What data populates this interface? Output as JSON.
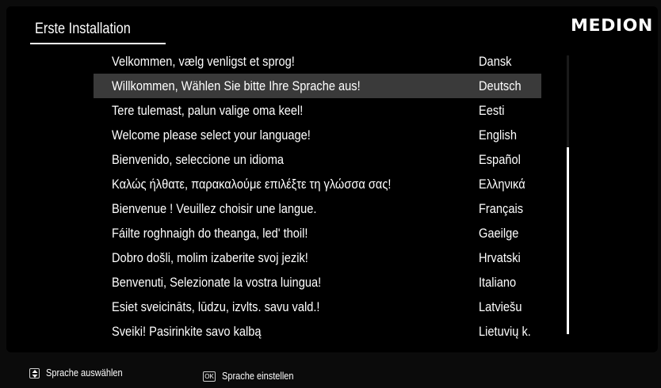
{
  "header": {
    "title": "Erste Installation",
    "brand": "MEDION"
  },
  "languages": [
    {
      "greeting": "Velkommen, vælg venligst et sprog!",
      "language": "Dansk",
      "selected": false
    },
    {
      "greeting": "Willkommen, Wählen Sie bitte Ihre Sprache aus!",
      "language": "Deutsch",
      "selected": true
    },
    {
      "greeting": "Tere tulemast, palun valige oma keel!",
      "language": "Eesti",
      "selected": false
    },
    {
      "greeting": "Welcome please select your language!",
      "language": "English",
      "selected": false
    },
    {
      "greeting": "Bienvenido, seleccione un idioma",
      "language": "Español",
      "selected": false
    },
    {
      "greeting": "Καλώς ήλθατε, παρακαλούμε επιλέξτε τη γλώσσα σας!",
      "language": "Ελληνικά",
      "selected": false
    },
    {
      "greeting": "Bienvenue ! Veuillez choisir une langue.",
      "language": "Français",
      "selected": false
    },
    {
      "greeting": "Fáilte roghnaigh do theanga, led' thoil!",
      "language": "Gaeilge",
      "selected": false
    },
    {
      "greeting": "Dobro došli, molim izaberite svoj jezik!",
      "language": "Hrvatski",
      "selected": false
    },
    {
      "greeting": "Benvenuti, Selezionate la vostra luingua!",
      "language": "Italiano",
      "selected": false
    },
    {
      "greeting": "Esiet sveicināts, lūdzu, izvlts. savu vald.!",
      "language": "Latviešu",
      "selected": false
    },
    {
      "greeting": "Sveiki! Pasirinkite savo kalbą",
      "language": "Lietuvių k.",
      "selected": false
    }
  ],
  "footer": {
    "hint_select": {
      "icon": "up-down-key-icon",
      "label": "Sprache auswählen"
    },
    "hint_confirm": {
      "icon": "ok-key-icon",
      "key_label": "OK",
      "label": "Sprache einstellen"
    }
  },
  "colors": {
    "background": "#000000",
    "selection": "#3a3a3a",
    "text": "#ffffff"
  }
}
